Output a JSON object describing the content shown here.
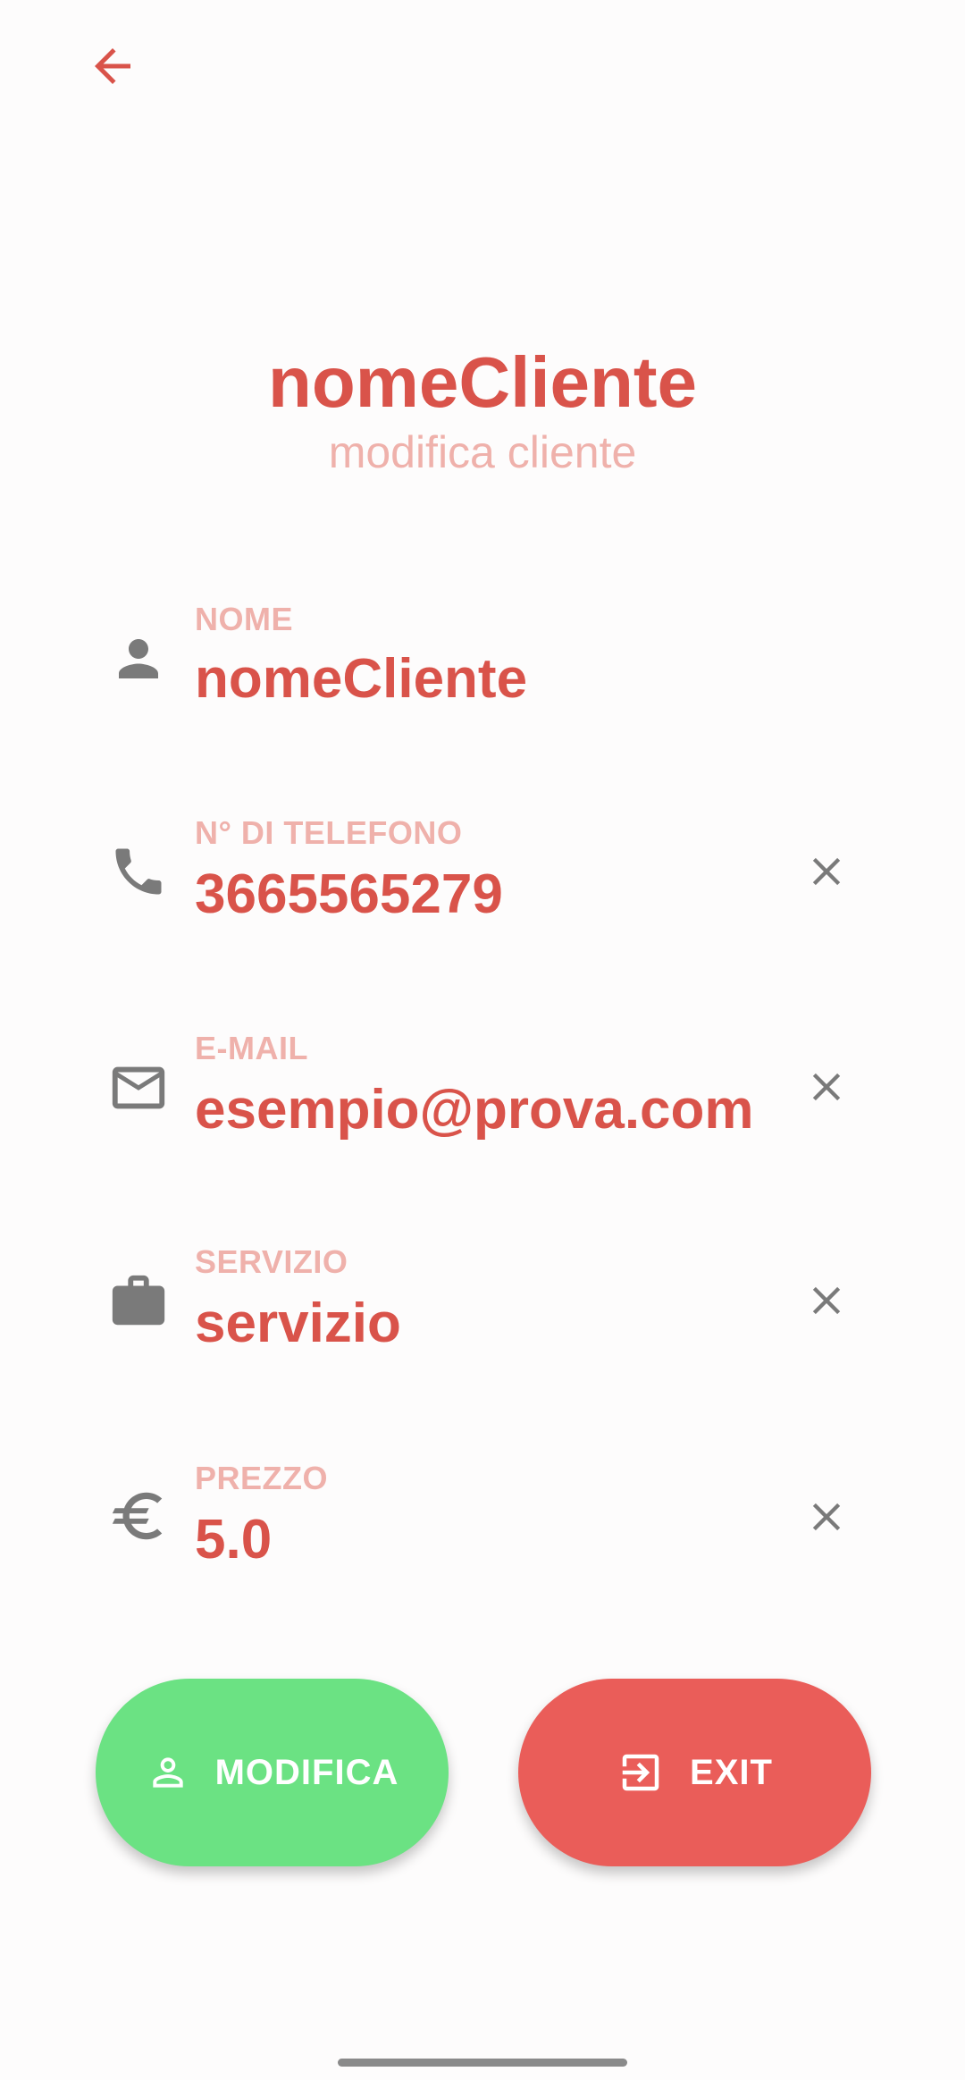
{
  "header": {
    "title": "nomeCliente",
    "subtitle": "modifica cliente"
  },
  "fields": [
    {
      "label": "NOME",
      "value": "nomeCliente",
      "icon": "person-icon",
      "clearable": false
    },
    {
      "label": "N° DI TELEFONO",
      "value": "3665565279",
      "icon": "phone-icon",
      "clearable": true
    },
    {
      "label": "E-MAIL",
      "value": "esempio@prova.com",
      "icon": "mail-icon",
      "clearable": true
    },
    {
      "label": "SERVIZIO",
      "value": "servizio",
      "icon": "briefcase-icon",
      "clearable": true
    },
    {
      "label": "PREZZO",
      "value": "5.0",
      "icon": "euro-icon",
      "clearable": true
    }
  ],
  "actions": {
    "modifica_label": "MODIFICA",
    "exit_label": "EXIT"
  },
  "colors": {
    "accent": "#d9534a",
    "label": "#efb1ab",
    "icon_gray": "#7a7a7a",
    "modifica_button": "#6be283",
    "exit_button": "#ea5d59"
  }
}
